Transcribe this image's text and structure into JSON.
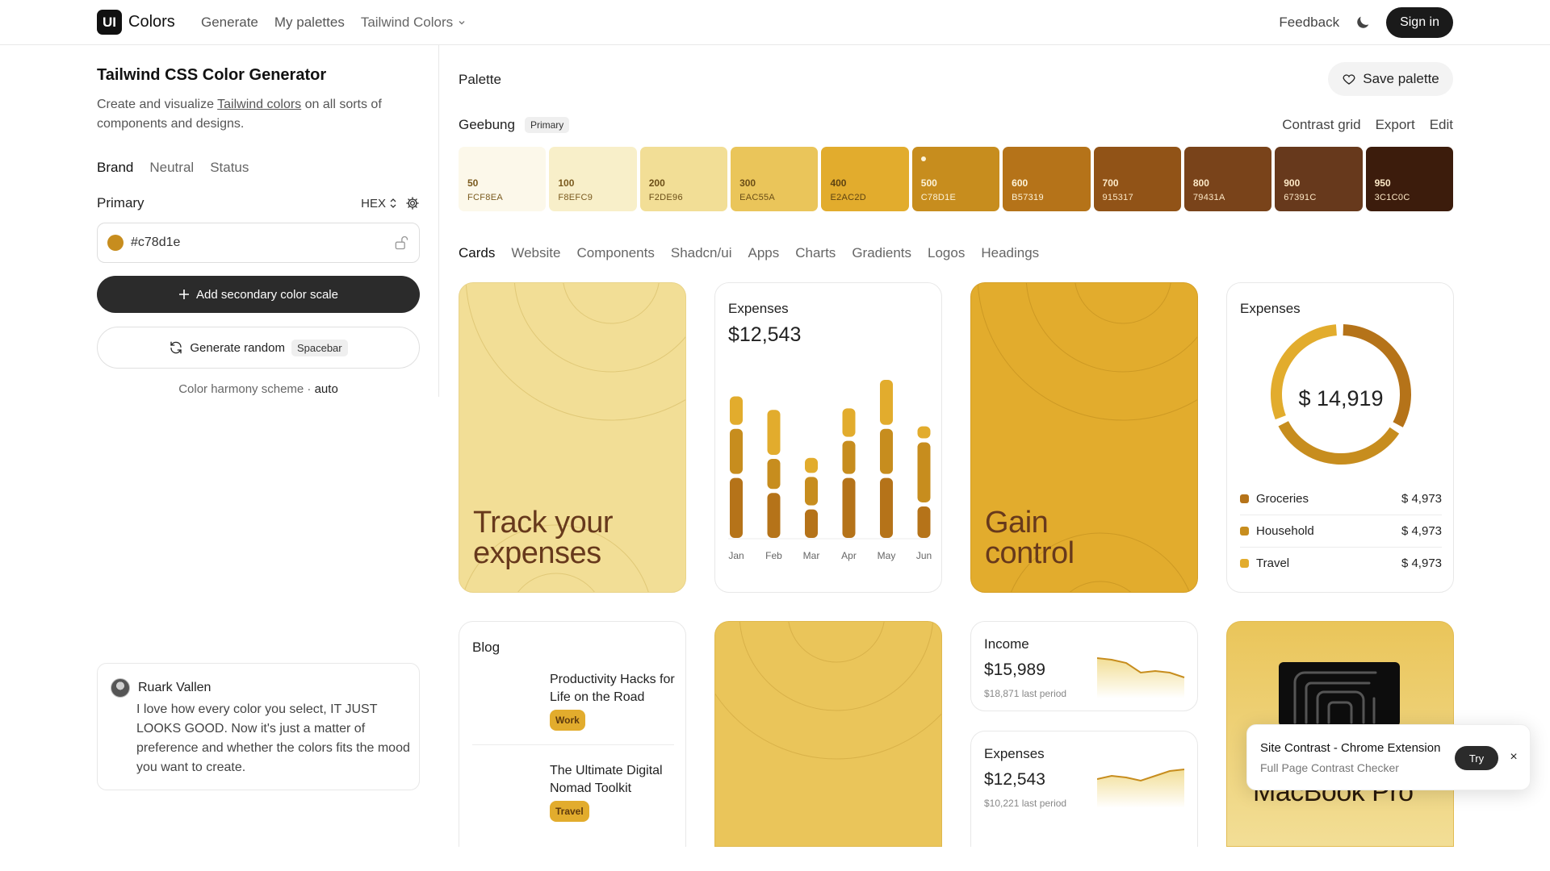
{
  "header": {
    "logo_mark": "UI",
    "logo_text": "Colors",
    "nav": [
      "Generate",
      "My palettes"
    ],
    "nav_dropdown": "Tailwind Colors",
    "feedback": "Feedback",
    "signin": "Sign in"
  },
  "left": {
    "title": "Tailwind CSS Color Generator",
    "desc_before": "Create and visualize ",
    "desc_link": "Tailwind colors",
    "desc_after": " on all sorts of components and designs.",
    "tabs": [
      "Brand",
      "Neutral",
      "Status"
    ],
    "primary_label": "Primary",
    "format": "HEX",
    "hex_value": "#c78d1e",
    "add_secondary": "Add secondary color scale",
    "generate_random": "Generate random",
    "shortcut": "Spacebar",
    "harmony_text": "Color harmony scheme · ",
    "harmony_value": "auto"
  },
  "testimonial": {
    "name": "Ruark Vallen",
    "quote": "I love how every color you select, IT JUST LOOKS GOOD. Now it's just a matter of preference and whether the colors fits the mood you want to create."
  },
  "palette": {
    "label": "Palette",
    "save": "Save palette",
    "scale_name": "Geebung",
    "scale_badge": "Primary",
    "actions": [
      "Contrast grid",
      "Export",
      "Edit"
    ],
    "shades": [
      {
        "step": "50",
        "code": "FCF8EA",
        "hex": "#FCF8EA",
        "text": "#7a5a1e"
      },
      {
        "step": "100",
        "code": "F8EFC9",
        "hex": "#F8EFC9",
        "text": "#7a5a1e"
      },
      {
        "step": "200",
        "code": "F2DE96",
        "hex": "#F2DE96",
        "text": "#6b4e17"
      },
      {
        "step": "300",
        "code": "EAC55A",
        "hex": "#EAC55A",
        "text": "#6b4e17"
      },
      {
        "step": "400",
        "code": "E2AC2D",
        "hex": "#E2AC2D",
        "text": "#5e4312"
      },
      {
        "step": "500",
        "code": "C78D1E",
        "hex": "#C78D1E",
        "text": "#fdf3d9"
      },
      {
        "step": "600",
        "code": "B57319",
        "hex": "#B57319",
        "text": "#fdf3d9"
      },
      {
        "step": "700",
        "code": "915317",
        "hex": "#915317",
        "text": "#fde9c7"
      },
      {
        "step": "800",
        "code": "79431A",
        "hex": "#79431A",
        "text": "#fde9c7"
      },
      {
        "step": "900",
        "code": "67391C",
        "hex": "#67391C",
        "text": "#fde9c7"
      },
      {
        "step": "950",
        "code": "3C1C0C",
        "hex": "#3C1C0C",
        "text": "#fde9c7"
      }
    ]
  },
  "sub_tabs": [
    "Cards",
    "Website",
    "Components",
    "Shadcn/ui",
    "Apps",
    "Charts",
    "Gradients",
    "Logos",
    "Headings"
  ],
  "cards": {
    "track": "Track your expenses",
    "gain": "Gain control",
    "expenses_label": "Expenses",
    "expenses_value": "$12,543",
    "donut_label": "Expenses",
    "donut_value": "$ 14,919",
    "legend": [
      {
        "name": "Groceries",
        "value": "$ 4,973",
        "color": "#B57319"
      },
      {
        "name": "Household",
        "value": "$ 4,973",
        "color": "#C78D1E"
      },
      {
        "name": "Travel",
        "value": "$ 4,973",
        "color": "#E2AC2D"
      }
    ],
    "blog_label": "Blog",
    "blog": [
      {
        "title": "Productivity Hacks for Life on the Road",
        "tag": "Work"
      },
      {
        "title": "The Ultimate Digital Nomad Toolkit",
        "tag": "Travel"
      }
    ],
    "income_label": "Income",
    "income_value": "$15,989",
    "income_sub": "$18,871 last period",
    "exp2_label": "Expenses",
    "exp2_value": "$12,543",
    "exp2_sub": "$10,221 last period",
    "macbook_text": "MacBook Pro"
  },
  "chart_data": {
    "type": "bar",
    "categories": [
      "Jan",
      "Feb",
      "Mar",
      "Apr",
      "May",
      "Jun"
    ],
    "series": [
      {
        "values": [
          80,
          60,
          38,
          80,
          80,
          42
        ]
      },
      {
        "values": [
          60,
          40,
          38,
          44,
          60,
          80
        ]
      },
      {
        "values": [
          38,
          60,
          20,
          38,
          60,
          16
        ]
      }
    ],
    "colors": [
      "#B57319",
      "#C78D1E",
      "#E2AC2D"
    ],
    "xlabel": "",
    "ylabel": ""
  },
  "toast": {
    "title": "Site Contrast - Chrome Extension",
    "subtitle": "Full Page Contrast Checker",
    "try": "Try",
    "close": "×"
  }
}
